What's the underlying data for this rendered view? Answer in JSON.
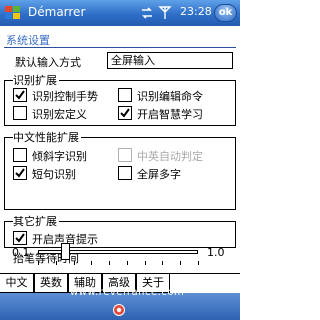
{
  "titlebar": {
    "app_title": "Démarrer",
    "clock": "23:28",
    "ok_label": "ok",
    "icons": [
      "windows-flag-icon",
      "connectivity-icon",
      "signal-icon",
      "volume-icon"
    ]
  },
  "page": {
    "heading": "系统设置"
  },
  "input_method": {
    "label": "默认输入方式",
    "value": "全屏输入"
  },
  "recognition_ext": {
    "title": "识别扩展",
    "items": [
      {
        "label": "识别控制手势",
        "checked": true,
        "enabled": true
      },
      {
        "label": "识别编辑命令",
        "checked": false,
        "enabled": true
      },
      {
        "label": "识别宏定义",
        "checked": false,
        "enabled": true
      },
      {
        "label": "开启智慧学习",
        "checked": true,
        "enabled": true
      }
    ]
  },
  "chinese_ext": {
    "title": "中文性能扩展",
    "items": [
      {
        "label": "倾斜字识别",
        "checked": false,
        "enabled": true
      },
      {
        "label": "中英自动判定",
        "checked": false,
        "enabled": false
      },
      {
        "label": "短句识别",
        "checked": true,
        "enabled": true
      },
      {
        "label": "全屏多字",
        "checked": false,
        "enabled": true
      }
    ]
  },
  "other_ext": {
    "title": "其它扩展",
    "items": [
      {
        "label": "开启声音提示",
        "checked": true,
        "enabled": true
      }
    ]
  },
  "pen_wait": {
    "title": "抬笔等待时间",
    "min_label": "0.1",
    "max_label": "1.0",
    "value": 0.25
  },
  "tabs": [
    {
      "label": "中文",
      "active": true
    },
    {
      "label": "英数",
      "active": false
    },
    {
      "label": "辅助",
      "active": false
    },
    {
      "label": "高级",
      "active": false
    },
    {
      "label": "关于",
      "active": false
    }
  ],
  "watermark": "www.revefrance.com",
  "colors": {
    "titlebar": "#2f6fc8",
    "heading_text": "#3a6fc4",
    "menubar": "#2e62b2"
  }
}
